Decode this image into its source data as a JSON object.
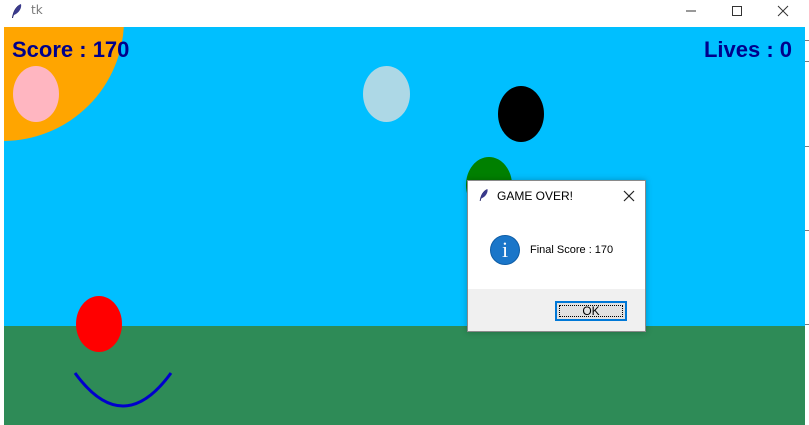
{
  "window": {
    "title": "tk",
    "icon": "feather-icon",
    "controls": [
      "minimize-icon",
      "maximize-icon",
      "close-icon"
    ]
  },
  "game": {
    "score_text": "Score : 170",
    "lives_text": "Lives : 0",
    "colors": {
      "sky": "#00bfff",
      "ground": "#2e8b57",
      "sun": "#ffa500",
      "hud_text": "#00008b",
      "catcher": "#0000cd",
      "balls": [
        "#ffb6c1",
        "#add8e6",
        "#000000",
        "#008000",
        "#ff0000"
      ]
    }
  },
  "dialog": {
    "title": "GAME OVER!",
    "icon": "info-icon",
    "icon_glyph": "i",
    "message": "Final Score : 170",
    "ok_label": "OK"
  }
}
